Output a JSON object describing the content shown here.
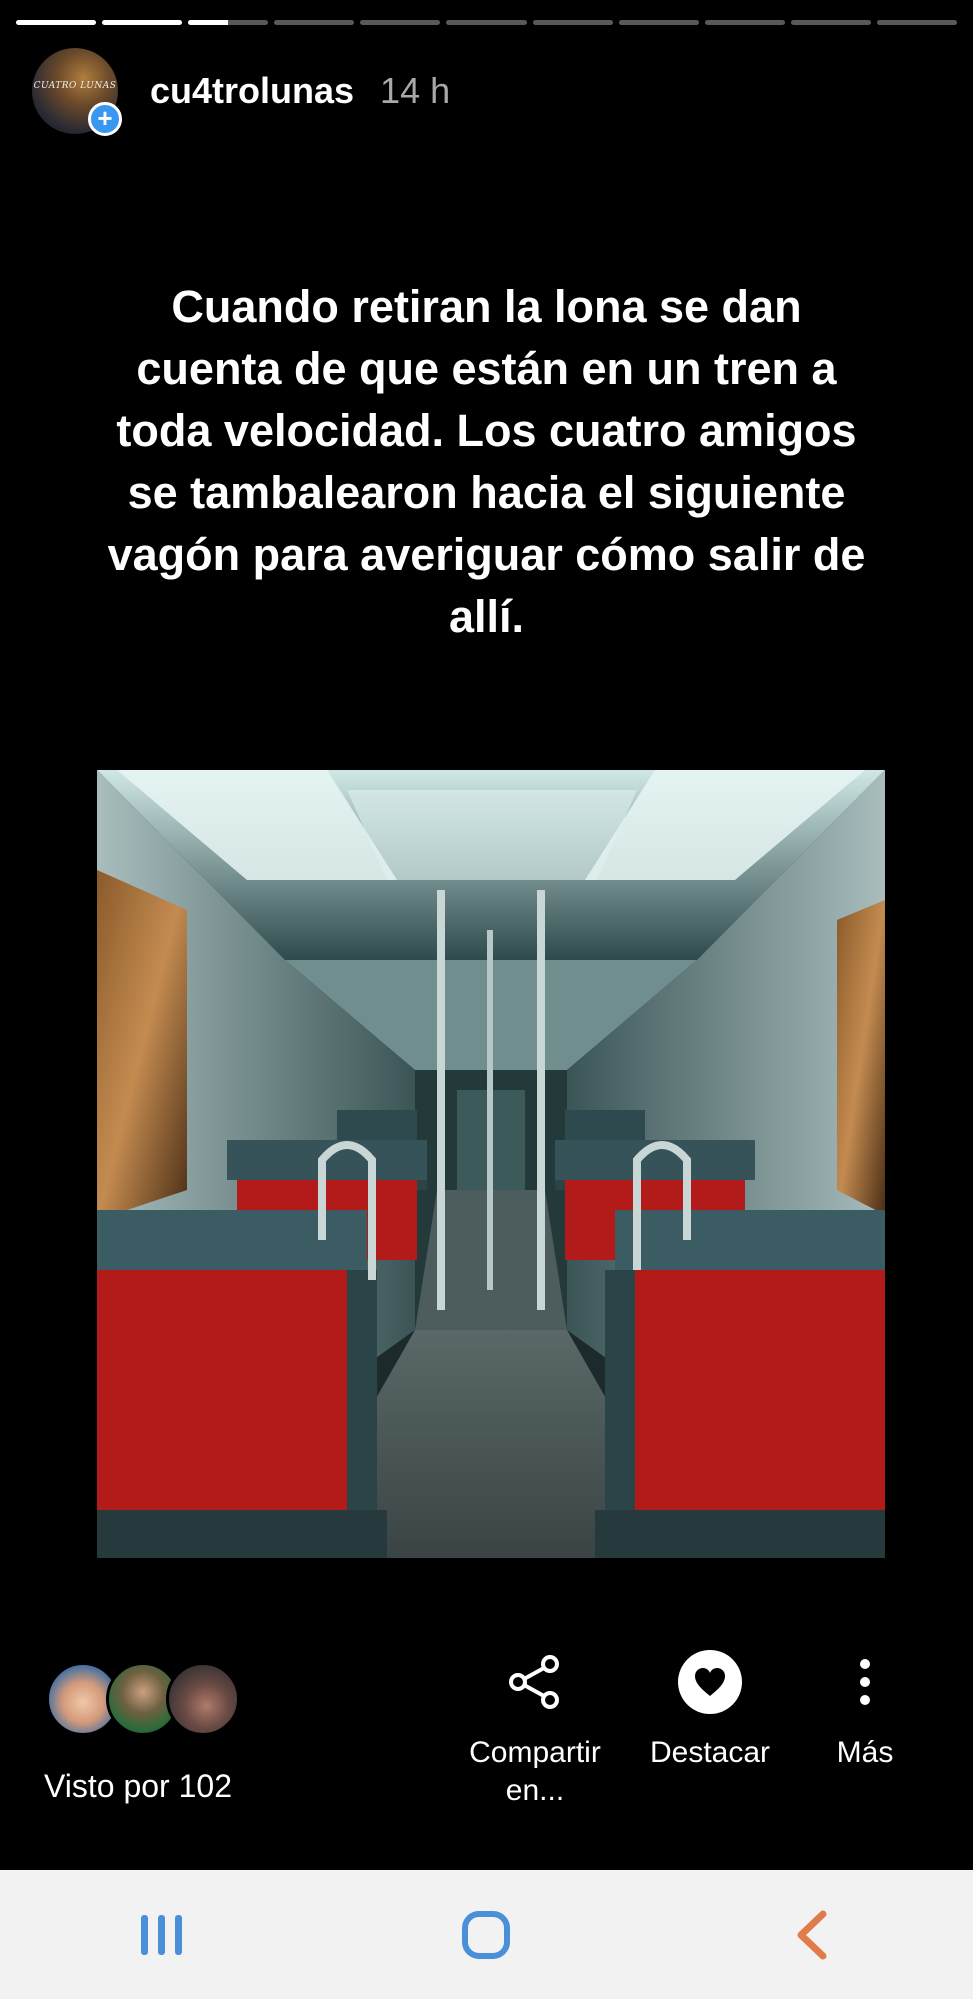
{
  "story": {
    "progress": [
      1,
      1,
      0.5,
      0,
      0,
      0,
      0,
      0,
      0,
      0,
      0
    ],
    "username": "cu4trolunas",
    "time_ago": "14 h",
    "avatar_text": "CUATRO LUNAS",
    "caption": "Cuando retiran la lona se dan cuenta de que están en un tren a toda velocidad. Los cuatro amigos se tambalearon hacia el siguiente vagón para averiguar cómo salir de allí."
  },
  "footer": {
    "seen_by": "Visto por 102",
    "share_label_1": "Compartir",
    "share_label_2": "en...",
    "highlight_label": "Destacar",
    "more_label": "Más"
  },
  "colors": {
    "badge_blue": "#3897f0",
    "seat_red": "#b31a1a",
    "nav_blue": "#4a90d9",
    "nav_back": "#e07b4a"
  },
  "navbar": {
    "icons": [
      "recent-apps-icon",
      "home-icon",
      "back-icon"
    ]
  }
}
